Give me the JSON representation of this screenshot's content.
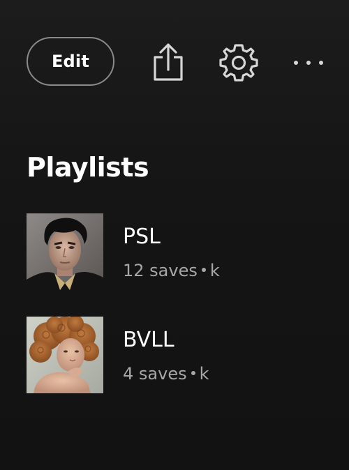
{
  "header": {
    "edit_label": "Edit",
    "icons": {
      "share": "share-icon",
      "settings": "gear-icon",
      "more": "more-options-icon"
    }
  },
  "playlists_section": {
    "title": "Playlists",
    "items": [
      {
        "name": "PSL",
        "saves": "12 saves",
        "owner": "k",
        "thumbnail": "man-portrait"
      },
      {
        "name": "BVLL",
        "saves": "4 saves",
        "owner": "k",
        "thumbnail": "woman-curly-hair-portrait"
      }
    ]
  },
  "colors": {
    "background": "#121212",
    "text_primary": "#ffffff",
    "text_secondary": "#a7a7a7",
    "outline": "#8a8a8a"
  }
}
